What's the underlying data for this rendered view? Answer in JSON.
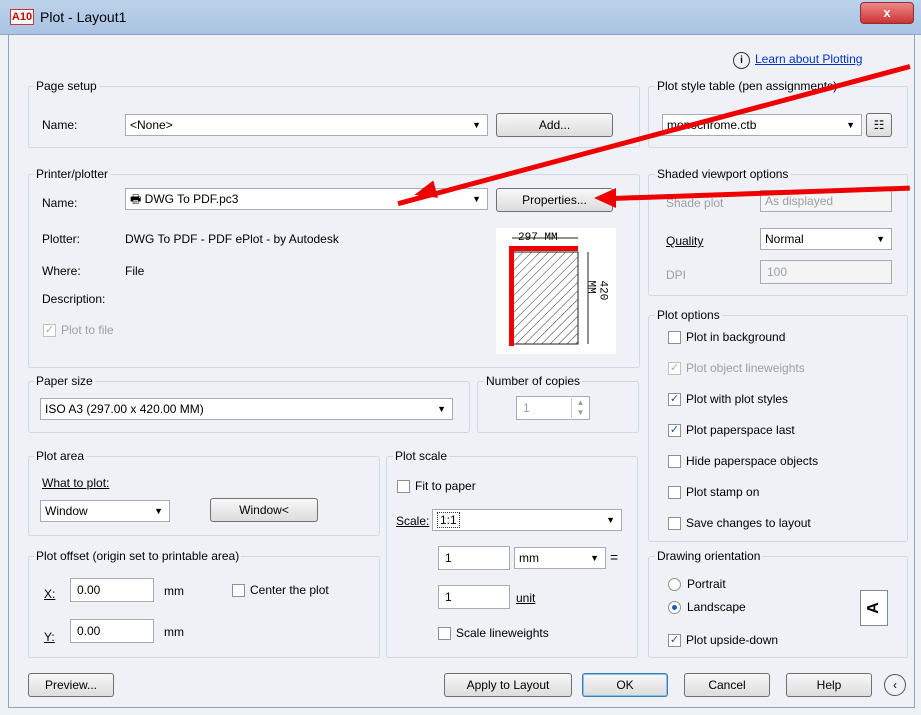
{
  "title": "Plot - Layout1",
  "app_logo": "A10",
  "close_glyph": "x",
  "learn_link": "Learn about Plotting",
  "page_setup": {
    "title": "Page setup",
    "name_label": "Name:",
    "name_value": "<None>",
    "add_button": "Add..."
  },
  "printer": {
    "title": "Printer/plotter",
    "name_label": "Name:",
    "name_value": "DWG To PDF.pc3",
    "properties_button": "Properties...",
    "plotter_label": "Plotter:",
    "plotter_value": "DWG To PDF - PDF ePlot - by Autodesk",
    "where_label": "Where:",
    "where_value": "File",
    "description_label": "Description:",
    "plot_to_file": "Plot to file",
    "width_dim": "297 MM",
    "height_dim": "420 MM"
  },
  "paper_size": {
    "title": "Paper size",
    "value": "ISO A3 (297.00 x 420.00 MM)"
  },
  "copies": {
    "title": "Number of copies",
    "value": "1"
  },
  "plot_area": {
    "title": "Plot area",
    "what_label": "What to plot:",
    "what_value": "Window",
    "window_button": "Window<"
  },
  "plot_offset": {
    "title": "Plot offset (origin set to printable area)",
    "x_label": "X:",
    "x_value": "0.00",
    "x_unit": "mm",
    "y_label": "Y:",
    "y_value": "0.00",
    "y_unit": "mm",
    "center_label": "Center the plot"
  },
  "plot_scale": {
    "title": "Plot scale",
    "fit_label": "Fit to paper",
    "scale_label": "Scale:",
    "scale_value": "1:1",
    "num1": "1",
    "unit_select": "mm",
    "equals": "=",
    "num2": "1",
    "unit_label": "unit",
    "lineweights_label": "Scale lineweights"
  },
  "plot_style": {
    "title": "Plot style table (pen assignments)",
    "value": "monochrome.ctb"
  },
  "shaded": {
    "title": "Shaded viewport options",
    "shade_label": "Shade plot",
    "shade_value": "As displayed",
    "quality_label": "Quality",
    "quality_value": "Normal",
    "dpi_label": "DPI",
    "dpi_value": "100"
  },
  "plot_options": {
    "title": "Plot options",
    "items": [
      {
        "label": "Plot in background",
        "checked": false,
        "disabled": false
      },
      {
        "label": "Plot object lineweights",
        "checked": true,
        "disabled": true
      },
      {
        "label": "Plot with plot styles",
        "checked": true,
        "disabled": false
      },
      {
        "label": "Plot paperspace last",
        "checked": true,
        "disabled": false
      },
      {
        "label": "Hide paperspace objects",
        "checked": false,
        "disabled": false
      },
      {
        "label": "Plot stamp on",
        "checked": false,
        "disabled": false
      },
      {
        "label": "Save changes to layout",
        "checked": false,
        "disabled": false
      }
    ]
  },
  "orientation": {
    "title": "Drawing orientation",
    "portrait": "Portrait",
    "landscape": "Landscape",
    "upside_down": "Plot upside-down"
  },
  "footer": {
    "preview": "Preview...",
    "apply": "Apply to Layout",
    "ok": "OK",
    "cancel": "Cancel",
    "help": "Help"
  },
  "accent_red": "#e00000"
}
